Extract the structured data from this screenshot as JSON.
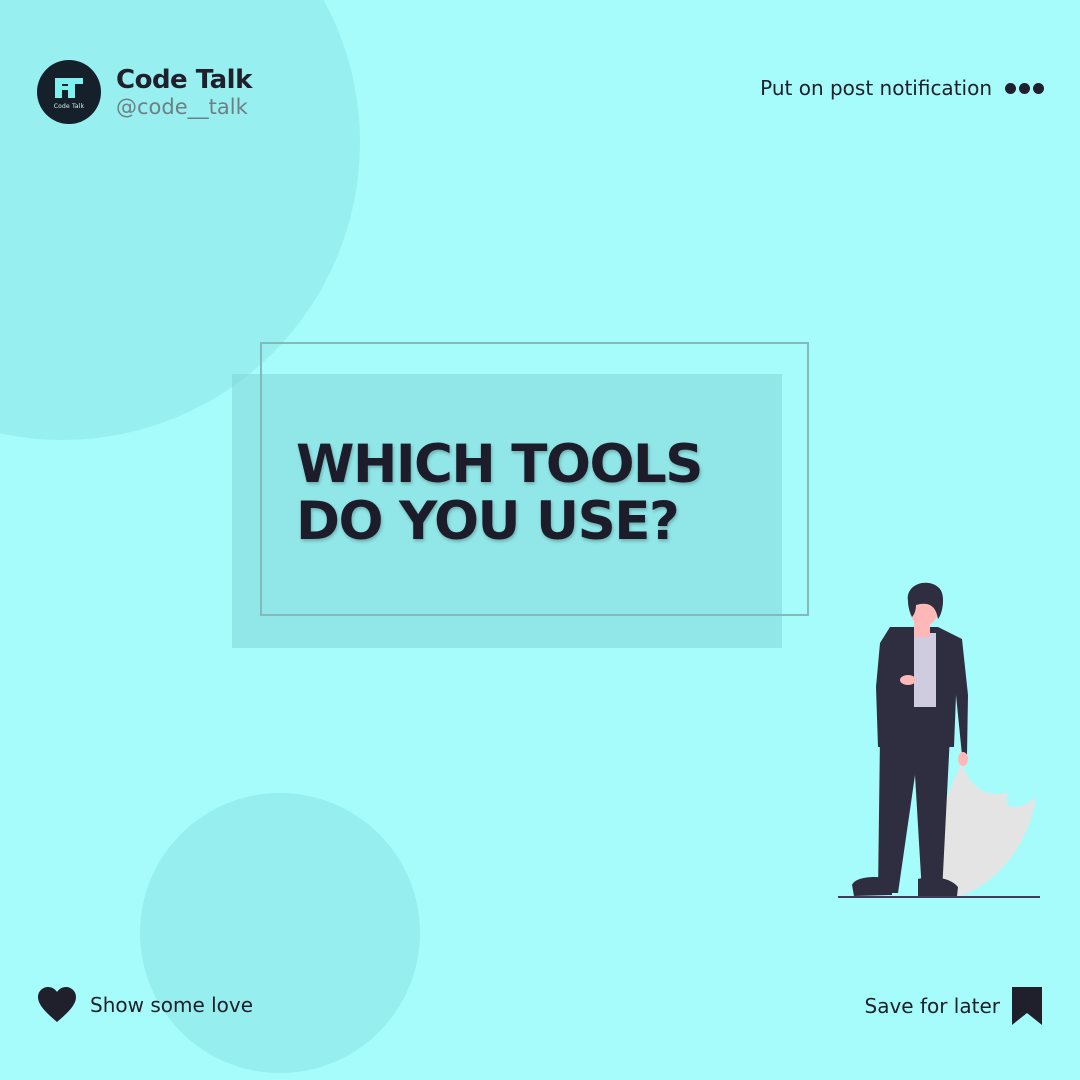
{
  "profile": {
    "name": "Code Talk",
    "handle": "@code__talk",
    "logo_label": "Code Talk"
  },
  "header": {
    "notification_text": "Put on post notification",
    "more_icon": "three-dots-icon"
  },
  "main": {
    "headline_line1": "WHICH TOOLS",
    "headline_line2": "DO YOU USE?"
  },
  "footer": {
    "love_label": "Show some love",
    "love_icon": "heart-icon",
    "save_label": "Save for later",
    "save_icon": "bookmark-icon"
  },
  "colors": {
    "background": "#a6fcfb",
    "accent_dark": "#20202c",
    "logo_cyan": "#7ff2ef"
  }
}
